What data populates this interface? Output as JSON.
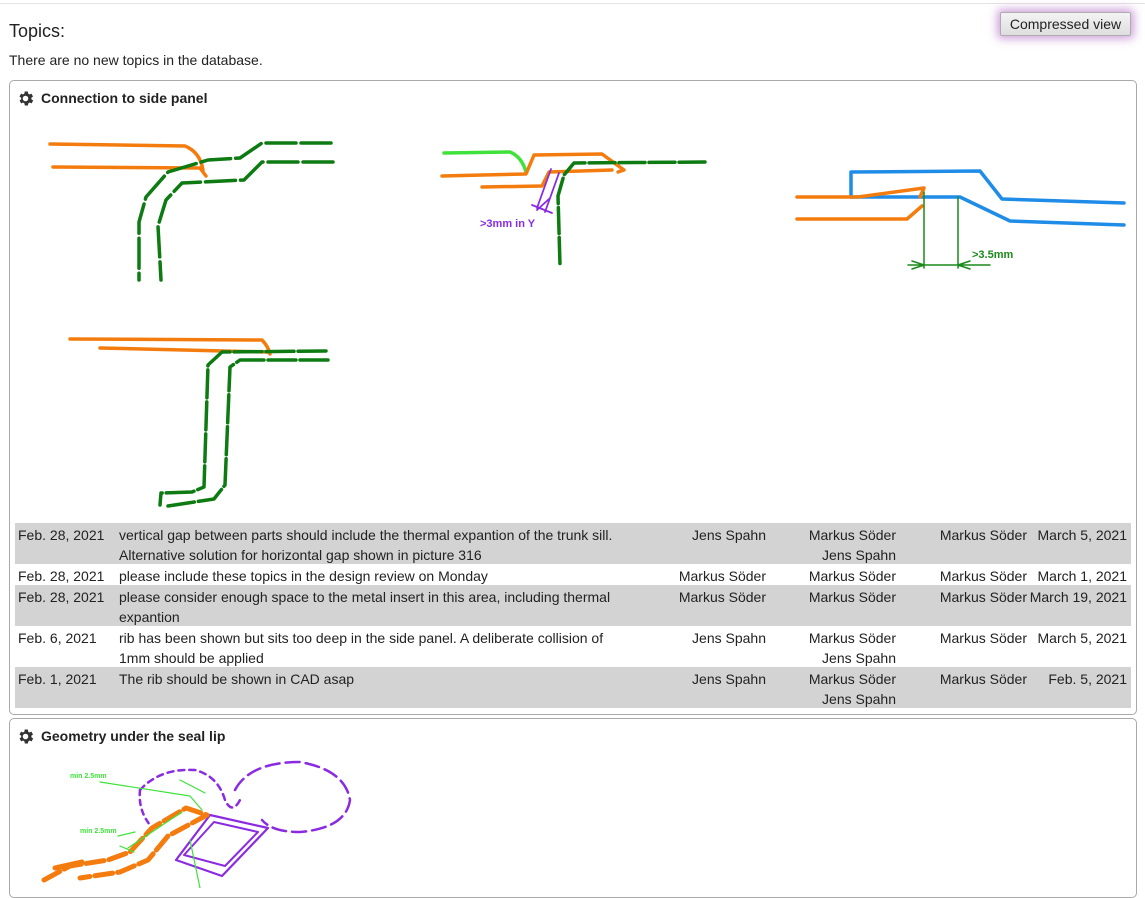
{
  "page": {
    "title": "Topics:",
    "subtitle": "There are no new topics in the database.",
    "compressed_view_label": "Compressed view"
  },
  "topics": [
    {
      "title": "Connection to side panel",
      "icon": "gear-icon",
      "sketch_labels": {
        "gap_y": ">3mm in Y",
        "gap_x": ">3.5mm"
      },
      "rows": [
        {
          "date": "Feb. 28, 2021",
          "desc": [
            "vertical gap between parts should include the thermal expantion of the trunk sill.",
            "Alternative solution for horizontal gap shown in picture 316"
          ],
          "responsible": "Jens Spahn",
          "participants": [
            "Markus Söder",
            "Jens Spahn"
          ],
          "author": "Markus Söder",
          "due": "March 5, 2021"
        },
        {
          "date": "Feb. 28, 2021",
          "desc": [
            "please include these topics in the design review on Monday"
          ],
          "responsible": "Markus Söder",
          "participants": [
            "Markus Söder"
          ],
          "author": "Markus Söder",
          "due": "March 1, 2021"
        },
        {
          "date": "Feb. 28, 2021",
          "desc": [
            "please consider enough space to the metal insert in this area, including thermal",
            "expantion"
          ],
          "responsible": "Markus Söder",
          "participants": [
            "Markus Söder"
          ],
          "author": "Markus Söder",
          "due": "March 19, 2021"
        },
        {
          "date": "Feb. 6, 2021",
          "desc": [
            "rib has been shown but sits too deep in the side panel. A deliberate collision of",
            "1mm should be applied"
          ],
          "responsible": "Jens Spahn",
          "participants": [
            "Markus Söder",
            "Jens Spahn"
          ],
          "author": "Markus Söder",
          "due": "March 5, 2021"
        },
        {
          "date": "Feb. 1, 2021",
          "desc": [
            "The rib should be shown in CAD asap"
          ],
          "responsible": "Jens Spahn",
          "participants": [
            "Markus Söder",
            "Jens Spahn"
          ],
          "author": "Markus Söder",
          "due": "Feb. 5, 2021"
        }
      ]
    },
    {
      "title": "Geometry under the seal lip",
      "icon": "gear-icon",
      "sketch_labels": {
        "min_a": "min 2.5mm",
        "min_b": "min 2.5mm"
      }
    }
  ],
  "colors": {
    "orange": "#f47c0f",
    "dark_green": "#0d7a12",
    "light_green": "#3ee23a",
    "blue": "#1f8ce8",
    "purple": "#8a2be2",
    "annotation_green": "#1a8a1a",
    "row_shade": "#d3d3d3"
  }
}
